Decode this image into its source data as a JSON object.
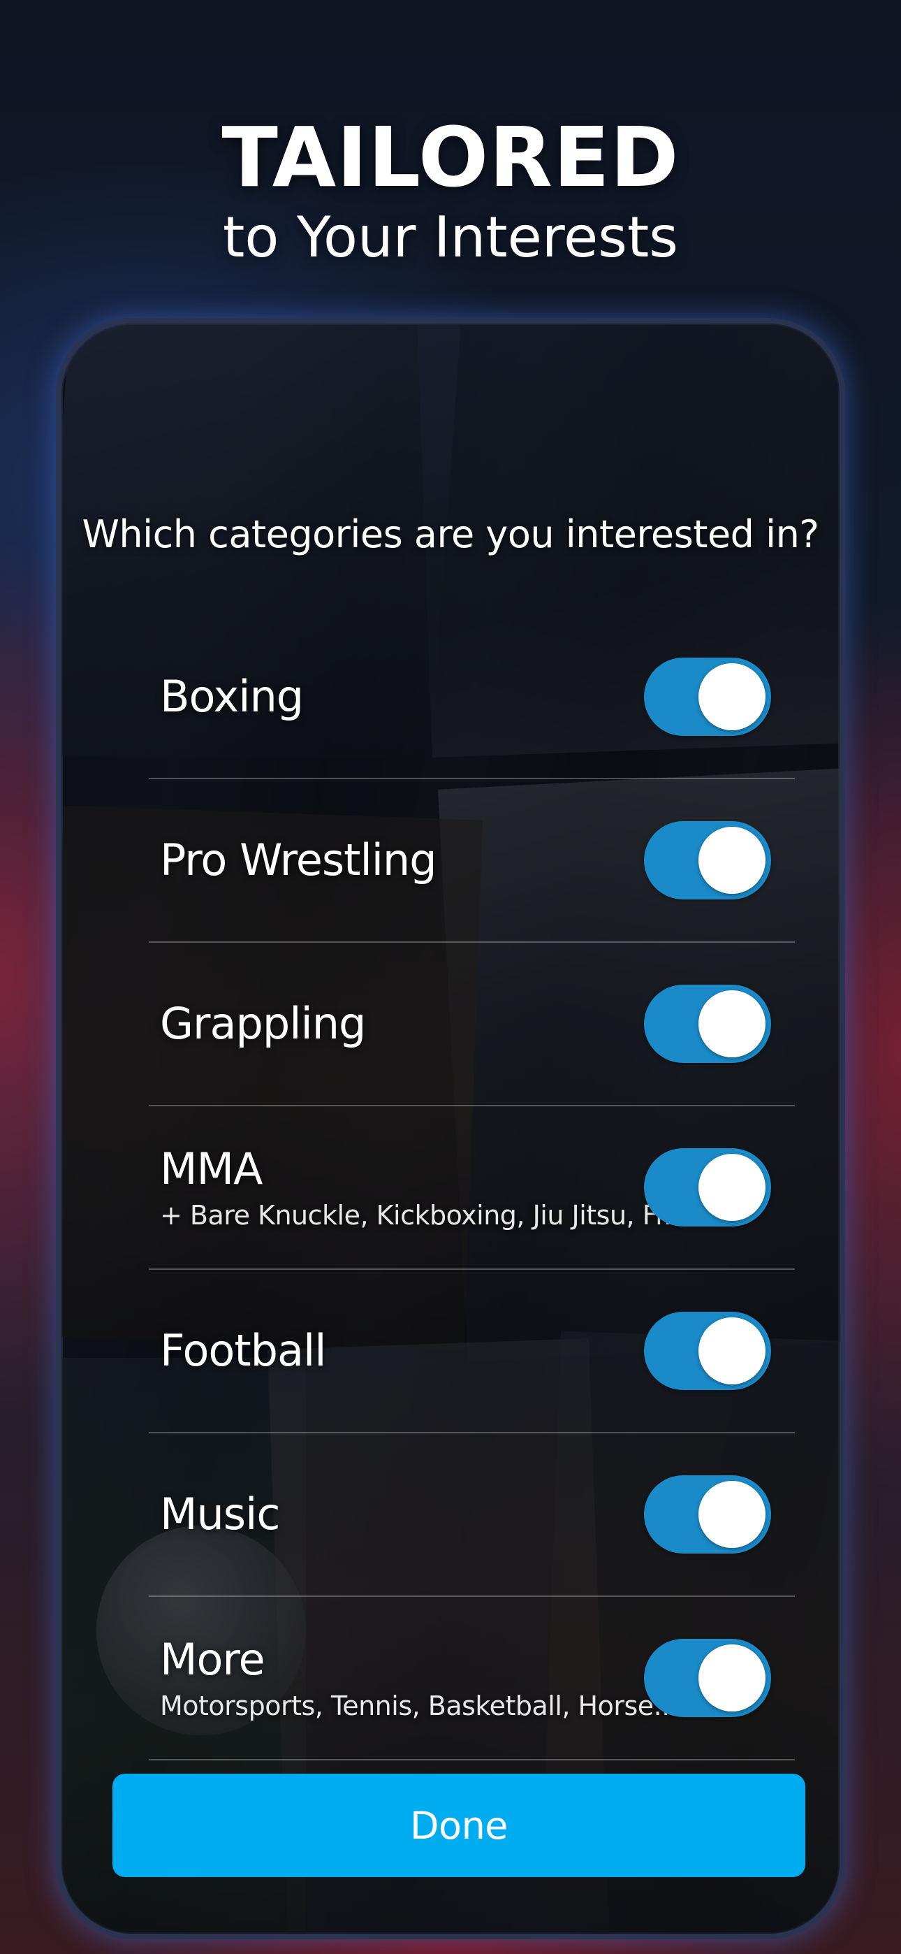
{
  "headline": {
    "title": "TAILORED",
    "subtitle": "to Your Interests"
  },
  "screen": {
    "question": "Which categories are you interested in?",
    "categories": [
      {
        "label": "Boxing",
        "detail": "",
        "enabled": true
      },
      {
        "label": "Pro Wrestling",
        "detail": "",
        "enabled": true
      },
      {
        "label": "Grappling",
        "detail": "",
        "enabled": true
      },
      {
        "label": "MMA",
        "detail": "+ Bare Knuckle, Kickboxing, Jiu Jitsu, Fr...",
        "enabled": true
      },
      {
        "label": "Football",
        "detail": "",
        "enabled": true
      },
      {
        "label": "Music",
        "detail": "",
        "enabled": true
      },
      {
        "label": "More",
        "detail": "Motorsports, Tennis, Basketball, Horse...",
        "enabled": true
      }
    ],
    "done_label": "Done"
  },
  "colors": {
    "toggle_on": "#1a8ac8",
    "button": "#00acf0"
  }
}
